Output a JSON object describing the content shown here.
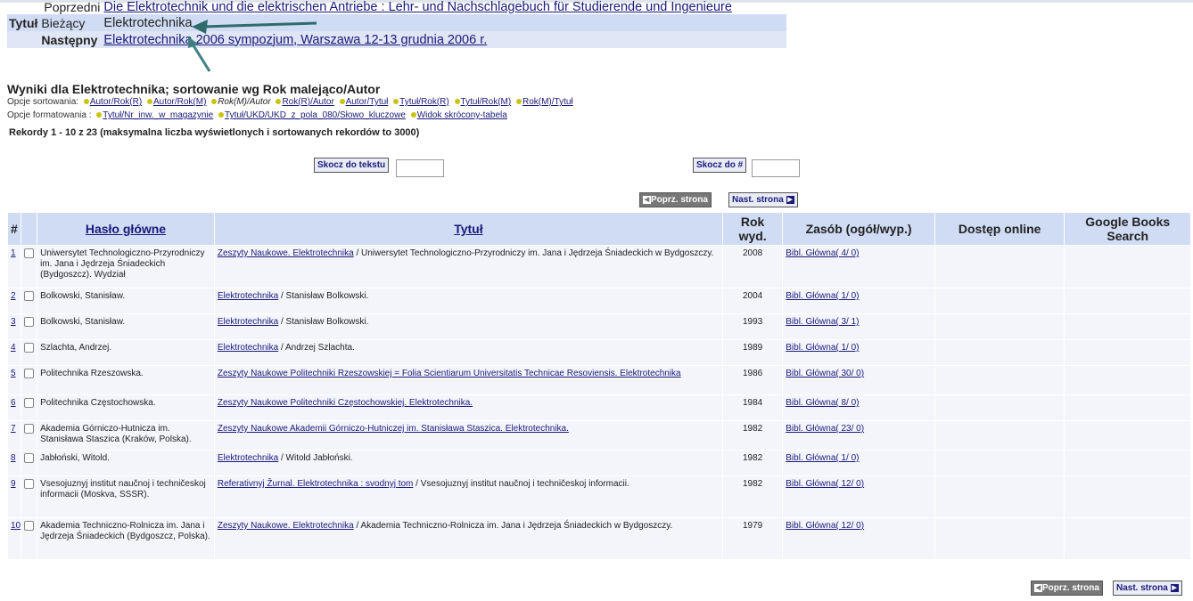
{
  "title_block": {
    "prev_label": "Poprzedni",
    "prev_title": "Die Elektrotechnik und die elektrischen Antriebe : Lehr- und Nachschlagebuch für Studierende und Ingenieure",
    "tytul_label": "Tytuł",
    "current_label": "Bieżący",
    "current_title": "Elektrotechnika",
    "next_label": "Następny",
    "next_title": "Elektrotechnika 2006 sympozjum, Warszawa 12-13 grudnia 2006 r."
  },
  "results_heading": "Wyniki dla Elektrotechnika; sortowanie wg Rok malejąco/Autor",
  "sort_options": {
    "label": "Opcje sortowania:",
    "links": [
      "Autor/Rok(R)",
      "Autor/Rok(M)"
    ],
    "current": "Rok(M)/Autor",
    "links2": [
      "Rok(R)/Autor",
      "Autor/Tytuł",
      "Tytuł/Rok(R)",
      "Tytuł/Rok(M)",
      "Rok(M)/Tytuł"
    ]
  },
  "format_options": {
    "label": "Opcje formatowania :",
    "links": [
      "Tytuł/Nr_inw._w_magazynie",
      "Tytuł/UKD/UKD_z_pola_080/Słowo_kluczowe",
      "Widok skrócony-tabela"
    ]
  },
  "records_text": "Rekordy 1 - 10 z 23 (maksymalna liczba wyświetlonych i sortowanych rekordów to 3000)",
  "buttons": {
    "jump_text": "Skocz do tekstu",
    "jump_num": "Skocz do #",
    "prev_page": "Poprz. strona",
    "next_page": "Nast. strona"
  },
  "table": {
    "headers": [
      "#",
      "Hasło główne",
      "Tytuł",
      "Rok wyd.",
      "Zasób (ogół/wyp.)",
      "Dostęp online",
      "Google Books Search"
    ],
    "rows": [
      {
        "num": "1",
        "author": "Uniwersytet Technologiczno-Przyrodniczy im. Jana i Jędrzeja Śniadeckich (Bydgoszcz). Wydział",
        "title_link": "Zeszyty Naukowe. Elektrotechnika",
        "title_rest": " / Uniwersytet Technologiczno-Przyrodniczy im. Jana i Jędrzeja Śniadeckich w Bydgoszczy.",
        "year": "2008",
        "holdings": "Bibl. Główna( 4/ 0)"
      },
      {
        "num": "2",
        "author": "Bolkowski, Stanisław.",
        "title_link": "Elektrotechnika",
        "title_rest": " / Stanisław Bolkowski.",
        "year": "2004",
        "holdings": "Bibl. Główna( 1/ 0)"
      },
      {
        "num": "3",
        "author": "Bolkowski, Stanisław.",
        "title_link": "Elektrotechnika",
        "title_rest": " / Stanisław Bolkowski.",
        "year": "1993",
        "holdings": "Bibl. Główna( 3/ 1)"
      },
      {
        "num": "4",
        "author": "Szlachta, Andrzej.",
        "title_link": "Elektrotechnika",
        "title_rest": " / Andrzej Szlachta.",
        "year": "1989",
        "holdings": "Bibl. Główna( 1/ 0)"
      },
      {
        "num": "5",
        "author": "Politechnika Rzeszowska.",
        "title_link": "Zeszyty Naukowe Politechniki Rzeszowskiej = Folia Scientiarum Universitatis Technicae Resoviensis. Elektrotechnika",
        "title_rest": "",
        "year": "1986",
        "holdings": "Bibl. Główna( 30/ 0)"
      },
      {
        "num": "6",
        "author": "Politechnika Częstochowska.",
        "title_link": "Zeszyty Naukowe Politechniki Częstochowskiej. Elektrotechnika.",
        "title_rest": "",
        "year": "1984",
        "holdings": "Bibl. Główna( 8/ 0)"
      },
      {
        "num": "7",
        "author": "Akademia Górniczo-Hutnicza im. Stanisława Staszica (Kraków, Polska).",
        "title_link": "Zeszyty Naukowe Akademii Górniczo-Hutniczej im. Stanisława Staszica. Elektrotechnika.",
        "title_rest": "",
        "year": "1982",
        "holdings": "Bibl. Główna( 23/ 0)"
      },
      {
        "num": "8",
        "author": "Jabłoński, Witold.",
        "title_link": "Elektrotechnika",
        "title_rest": " / Witold Jabłoński.",
        "year": "1982",
        "holdings": "Bibl. Główna( 1/ 0)"
      },
      {
        "num": "9",
        "author": "Vsesojuznyj institut naučnoj i techničeskoj informacii (Moskva, SSSR).",
        "title_link": "Referativnyj Žurnal. Elektrotechnika : svodnyj tom",
        "title_rest": " / Vsesojuznyj institut naučnoj i techničeskoj informacii.",
        "year": "1982",
        "holdings": "Bibl. Główna( 12/ 0)"
      },
      {
        "num": "10",
        "author": "Akademia Techniczno-Rolnicza im. Jana i Jędrzeja Śniadeckich (Bydgoszcz, Polska).",
        "title_link": "Zeszyty Naukowe. Elektrotechnika",
        "title_rest": " / Akademia Techniczno-Rolnicza im. Jana i Jędrzeja Śniadeckich w Bydgoszczy.",
        "year": "1979",
        "holdings": "Bibl. Główna( 12/ 0)"
      }
    ]
  }
}
